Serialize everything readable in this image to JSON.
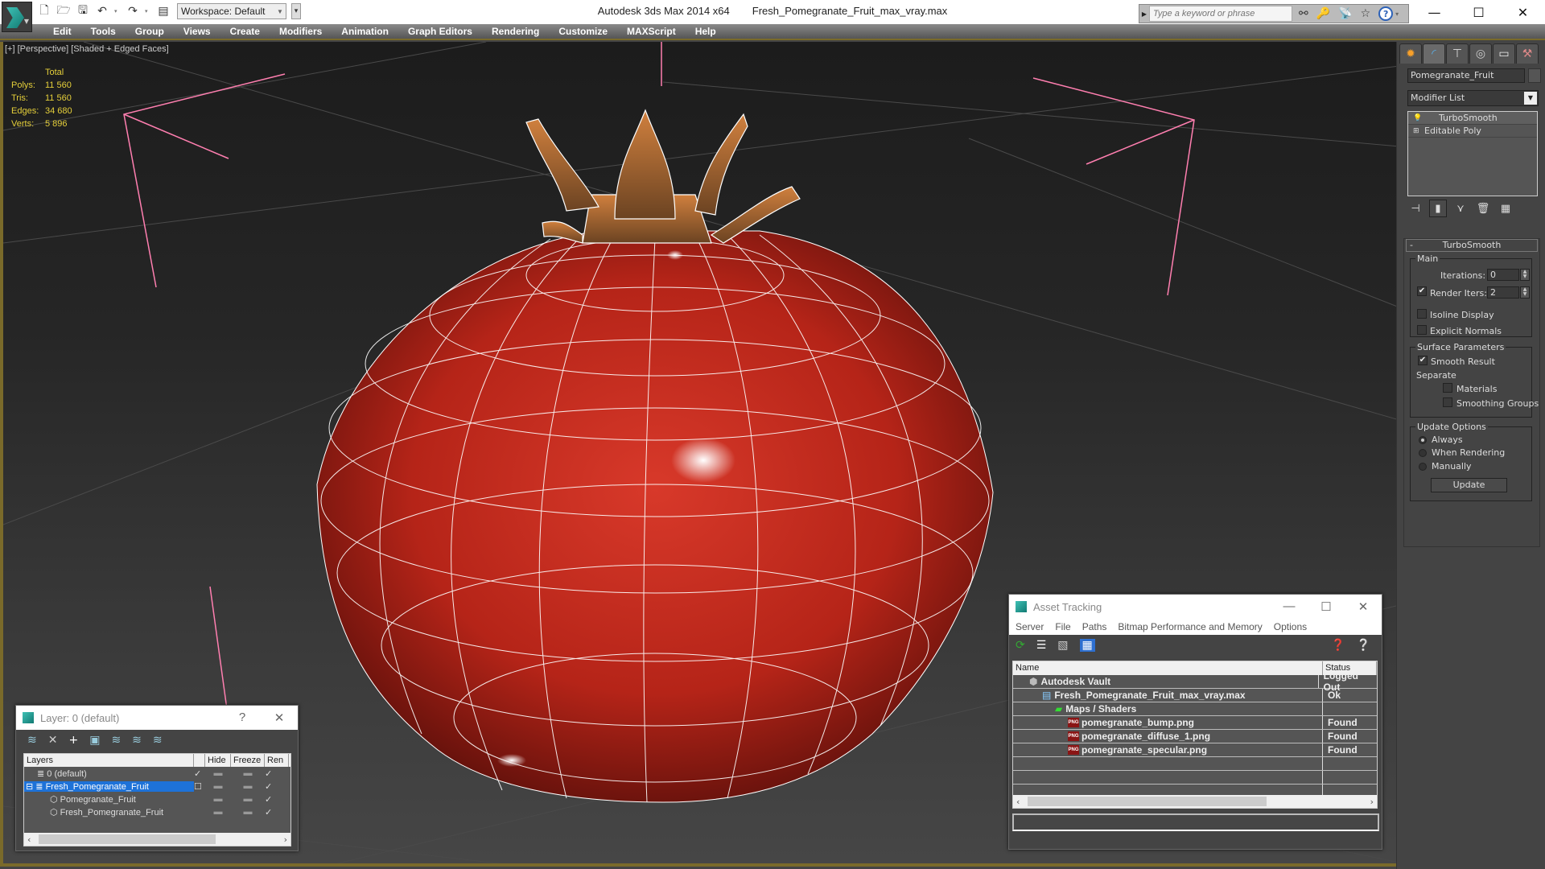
{
  "window": {
    "app_title": "Autodesk 3ds Max  2014 x64",
    "file_title": "Fresh_Pomegranate_Fruit_max_vray.max",
    "workspace": "Workspace: Default",
    "search_placeholder": "Type a keyword or phrase",
    "controls": {
      "minimize": "—",
      "maximize": "☐",
      "close": "✕"
    }
  },
  "quick_access": [
    "new-icon",
    "open-icon",
    "save-icon",
    "undo-icon",
    "redo-icon",
    "project-icon"
  ],
  "menu": [
    "Edit",
    "Tools",
    "Group",
    "Views",
    "Create",
    "Modifiers",
    "Animation",
    "Graph Editors",
    "Rendering",
    "Customize",
    "MAXScript",
    "Help"
  ],
  "viewport": {
    "label": "[+] [Perspective] [Shaded + Edged Faces]",
    "stats_header": "Total",
    "stats": [
      {
        "label": "Polys:",
        "value": "11 560"
      },
      {
        "label": "Tris:",
        "value": "11 560"
      },
      {
        "label": "Edges:",
        "value": "34 680"
      },
      {
        "label": "Verts:",
        "value": "5 896"
      }
    ]
  },
  "command_panel": {
    "tabs": [
      "create",
      "modify",
      "hierarchy",
      "motion",
      "display",
      "utilities"
    ],
    "object_name": "Pomegranate_Fruit",
    "modifier_list": "Modifier List",
    "stack": [
      "TurboSmooth",
      "Editable Poly"
    ],
    "rollout": {
      "title": "TurboSmooth",
      "collapse": "-",
      "main_group": "Main",
      "iterations_label": "Iterations:",
      "iterations_value": "0",
      "render_iters_label": "Render Iters:",
      "render_iters_value": "2",
      "render_iters_checked": true,
      "isoline_label": "Isoline Display",
      "explicit_normals_label": "Explicit Normals",
      "surface_group": "Surface Parameters",
      "smooth_result_label": "Smooth Result",
      "smooth_result_checked": true,
      "separate_label": "Separate",
      "materials_label": "Materials",
      "smoothing_groups_label": "Smoothing Groups",
      "update_group": "Update Options",
      "always_label": "Always",
      "when_rendering_label": "When Rendering",
      "manually_label": "Manually",
      "update_button": "Update",
      "selected_update_option": "Always"
    }
  },
  "layer_dialog": {
    "title": "Layer: 0 (default)",
    "help": "?",
    "close": "✕",
    "columns": [
      "Layers",
      "",
      "Hide",
      "Freeze",
      "Ren"
    ],
    "rows": [
      {
        "name": "0 (default)",
        "indent": 1,
        "active": true
      },
      {
        "name": "Fresh_Pomegranate_Fruit",
        "indent": 0,
        "selected": true
      },
      {
        "name": "Pomegranate_Fruit",
        "indent": 2
      },
      {
        "name": "Fresh_Pomegranate_Fruit",
        "indent": 2
      }
    ]
  },
  "asset_tracking": {
    "title": "Asset Tracking",
    "menu": [
      "Server",
      "File",
      "Paths",
      "Bitmap Performance and Memory",
      "Options"
    ],
    "columns": [
      "Name",
      "Status"
    ],
    "rows": [
      {
        "name": "Autodesk Vault",
        "status": "Logged Out",
        "indent": 1,
        "icon": "vault-icon"
      },
      {
        "name": "Fresh_Pomegranate_Fruit_max_vray.max",
        "status": "Ok",
        "indent": 2,
        "icon": "max-file-icon"
      },
      {
        "name": "Maps / Shaders",
        "status": "",
        "indent": 3,
        "icon": "maps-icon"
      },
      {
        "name": "pomegranate_bump.png",
        "status": "Found",
        "indent": 4,
        "icon": "png-icon"
      },
      {
        "name": "pomegranate_diffuse_1.png",
        "status": "Found",
        "indent": 4,
        "icon": "png-icon"
      },
      {
        "name": "pomegranate_specular.png",
        "status": "Found",
        "indent": 4,
        "icon": "png-icon"
      }
    ]
  },
  "colors": {
    "viewport_border": "#7a6a2a",
    "stats": "#e5cf3a",
    "selection": "#1e72d8",
    "gizmo": "#ff7fb0",
    "fruit": "#c0261c"
  }
}
